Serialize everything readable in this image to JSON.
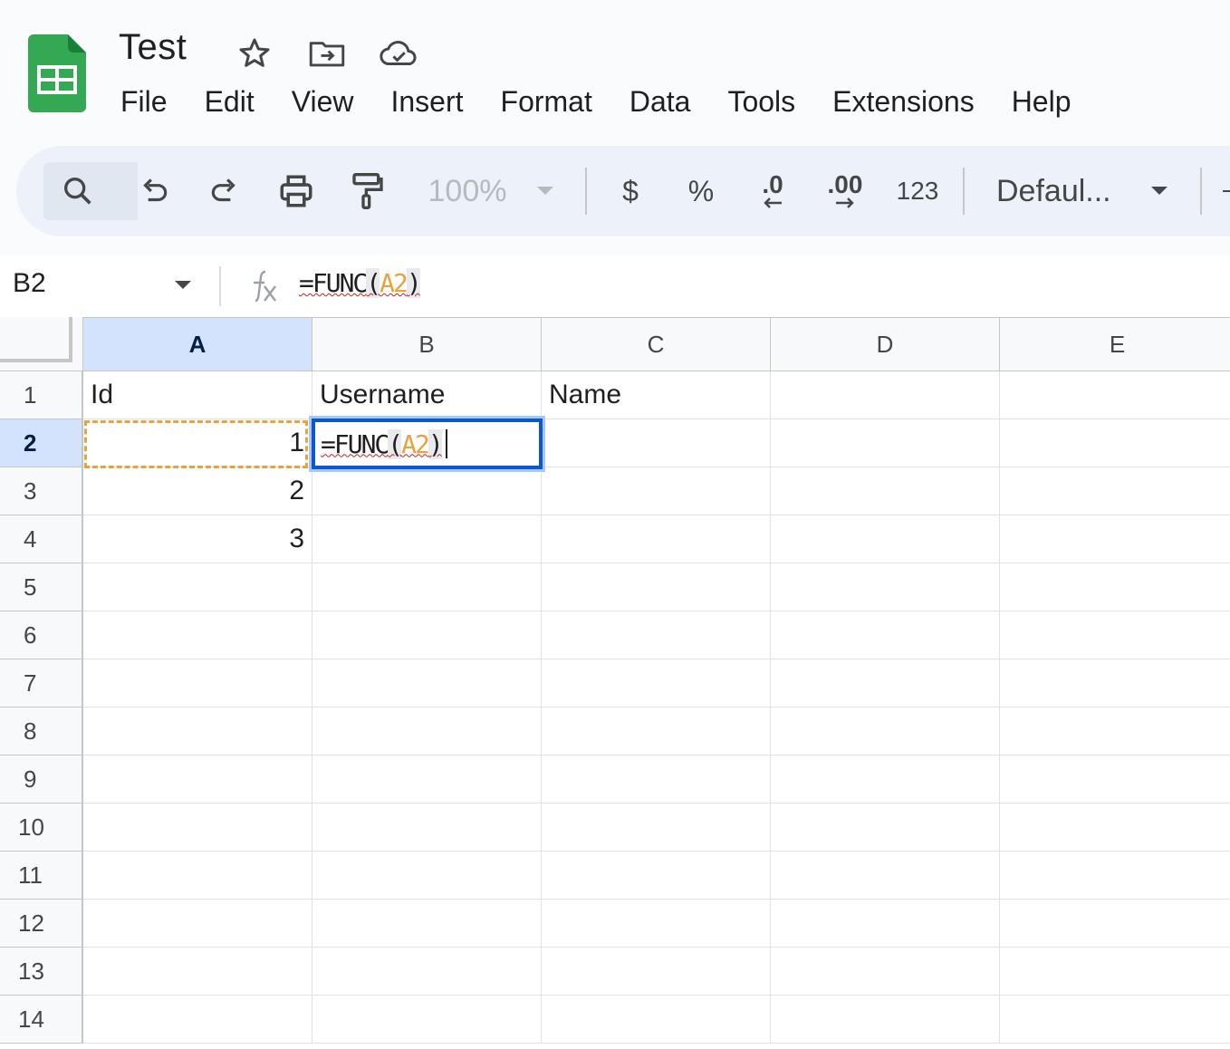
{
  "app": {
    "title": "Test",
    "brand_color": "#34a853",
    "icons": [
      "star-icon",
      "move-to-folder-icon",
      "cloud-saved-icon"
    ]
  },
  "menu": [
    "File",
    "Edit",
    "View",
    "Insert",
    "Format",
    "Data",
    "Tools",
    "Extensions",
    "Help"
  ],
  "toolbar": {
    "zoom": "100%",
    "currency": "$",
    "percent": "%",
    "decrease_decimal": ".0",
    "increase_decimal": ".00",
    "number_format": "123",
    "font": "Defaul..."
  },
  "formula_bar": {
    "name_box": "B2",
    "formula_prefix": "=FUNC",
    "paren_open": "(",
    "ref": "A2",
    "paren_close": ")"
  },
  "grid": {
    "columns": [
      "A",
      "B",
      "C",
      "D",
      "E"
    ],
    "rows": [
      "1",
      "2",
      "3",
      "4",
      "5",
      "6",
      "7",
      "8",
      "9",
      "10",
      "11",
      "12",
      "13",
      "14"
    ],
    "cells": {
      "A1": "Id",
      "B1": "Username",
      "C1": "Name",
      "A2": "1",
      "A3": "2",
      "A4": "3"
    },
    "active_cell": "B2",
    "active_edit": {
      "prefix": "=FUNC",
      "paren_open": "(",
      "ref": "A2",
      "paren_close": ")"
    },
    "selection_color": "#0b57d0",
    "reference_color": "#e8a33d"
  }
}
